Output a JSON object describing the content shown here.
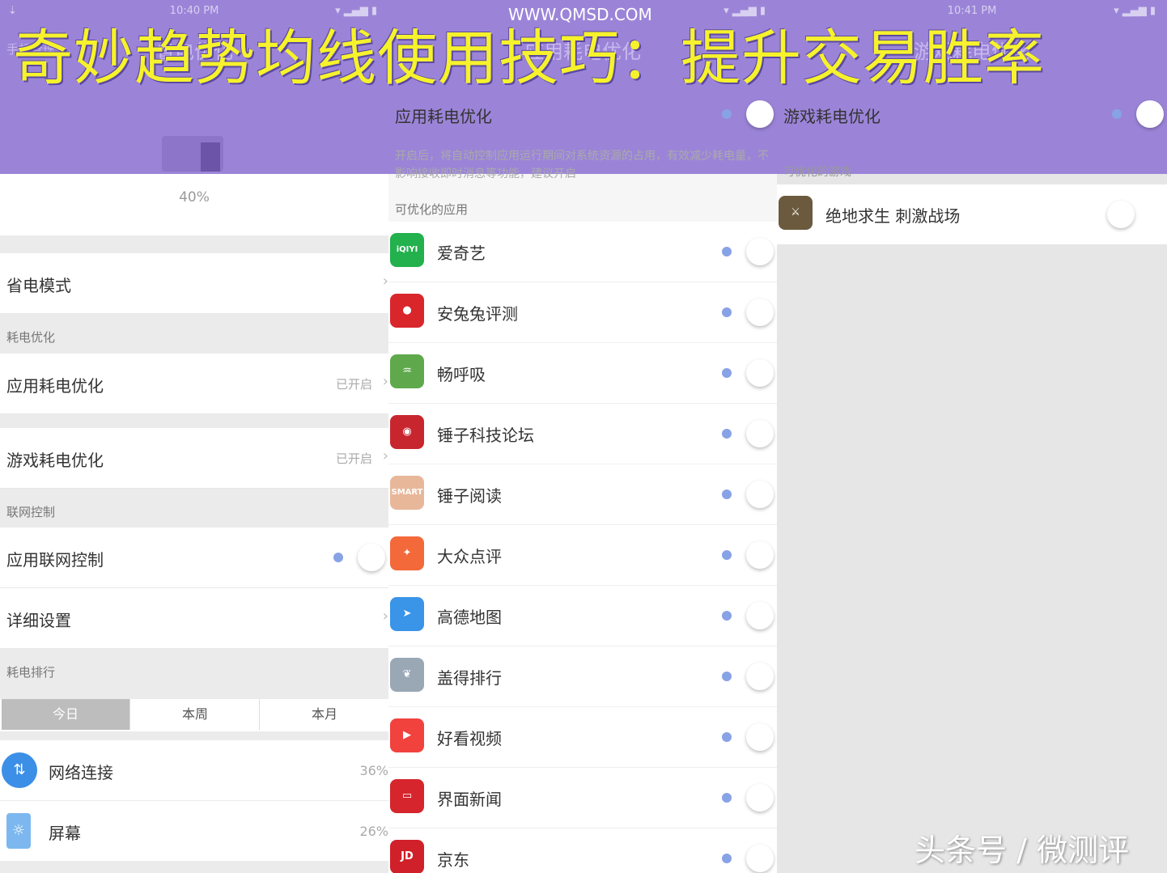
{
  "overlay": {
    "banner": "奇妙趋势均线使用技巧：提升交易胜率",
    "url": "WWW.QMSD.COM",
    "watermark": "头条号 / 微测评"
  },
  "panel1": {
    "status": {
      "time": "10:40 PM",
      "left": "⇣",
      "right": "▾ ▂▄▆ ▮"
    },
    "nav_back": "手机管理",
    "nav_title": "省电优化",
    "battery_level": 0.4,
    "battery_pct": "40%",
    "power_mode": {
      "label": "省电模式"
    },
    "section_drain": "耗电优化",
    "app_drain": {
      "label": "应用耗电优化",
      "state": "已开启"
    },
    "game_drain": {
      "label": "游戏耗电优化",
      "state": "已开启"
    },
    "section_net": "联网控制",
    "net_control": {
      "label": "应用联网控制"
    },
    "detail": {
      "label": "详细设置"
    },
    "section_rank": "耗电排行",
    "tabs": [
      "今日",
      "本周",
      "本月"
    ],
    "rank": [
      {
        "label": "网络连接",
        "pct": "36%",
        "icon": "⇅",
        "color": "#3c8fe6"
      },
      {
        "label": "屏幕",
        "pct": "26%",
        "icon": "☼",
        "color": "#7cb8ef"
      }
    ]
  },
  "panel2": {
    "status": {
      "time": "",
      "right": "▾ ▂▄▆ ▮"
    },
    "nav_title": "应用耗电优化",
    "title": "应用耗电优化",
    "desc": "开启后，将自动控制应用运行期间对系统资源的占用，有效减少耗电量，不影响接收即时消息等功能，建议开启",
    "section": "可优化的应用",
    "apps": [
      {
        "name": "爱奇艺",
        "icon": "iQIYI",
        "color": "#22b14c"
      },
      {
        "name": "安兔兔评测",
        "icon": "●",
        "color": "#d9262b"
      },
      {
        "name": "畅呼吸",
        "icon": "♒",
        "color": "#5fa94c"
      },
      {
        "name": "锤子科技论坛",
        "icon": "◉",
        "color": "#c8262f"
      },
      {
        "name": "锤子阅读",
        "icon": "SMART",
        "color": "#e8b79a"
      },
      {
        "name": "大众点评",
        "icon": "✦",
        "color": "#f4693a"
      },
      {
        "name": "高德地图",
        "icon": "➤",
        "color": "#3a94e8"
      },
      {
        "name": "盖得排行",
        "icon": "❦",
        "color": "#9aa7b5"
      },
      {
        "name": "好看视频",
        "icon": "▶",
        "color": "#f1423e"
      },
      {
        "name": "界面新闻",
        "icon": "▭",
        "color": "#d6252d"
      },
      {
        "name": "京东",
        "icon": "JD",
        "color": "#d0202a"
      }
    ]
  },
  "panel3": {
    "status": {
      "time": "10:41 PM",
      "right": "▾ ▂▄▆ ▮"
    },
    "nav_title": "游戏耗电优化",
    "title": "游戏耗电优化",
    "section": "可优化的游戏",
    "game": {
      "name": "绝地求生 刺激战场",
      "icon": "⚔",
      "color": "#6b5a3e"
    }
  }
}
